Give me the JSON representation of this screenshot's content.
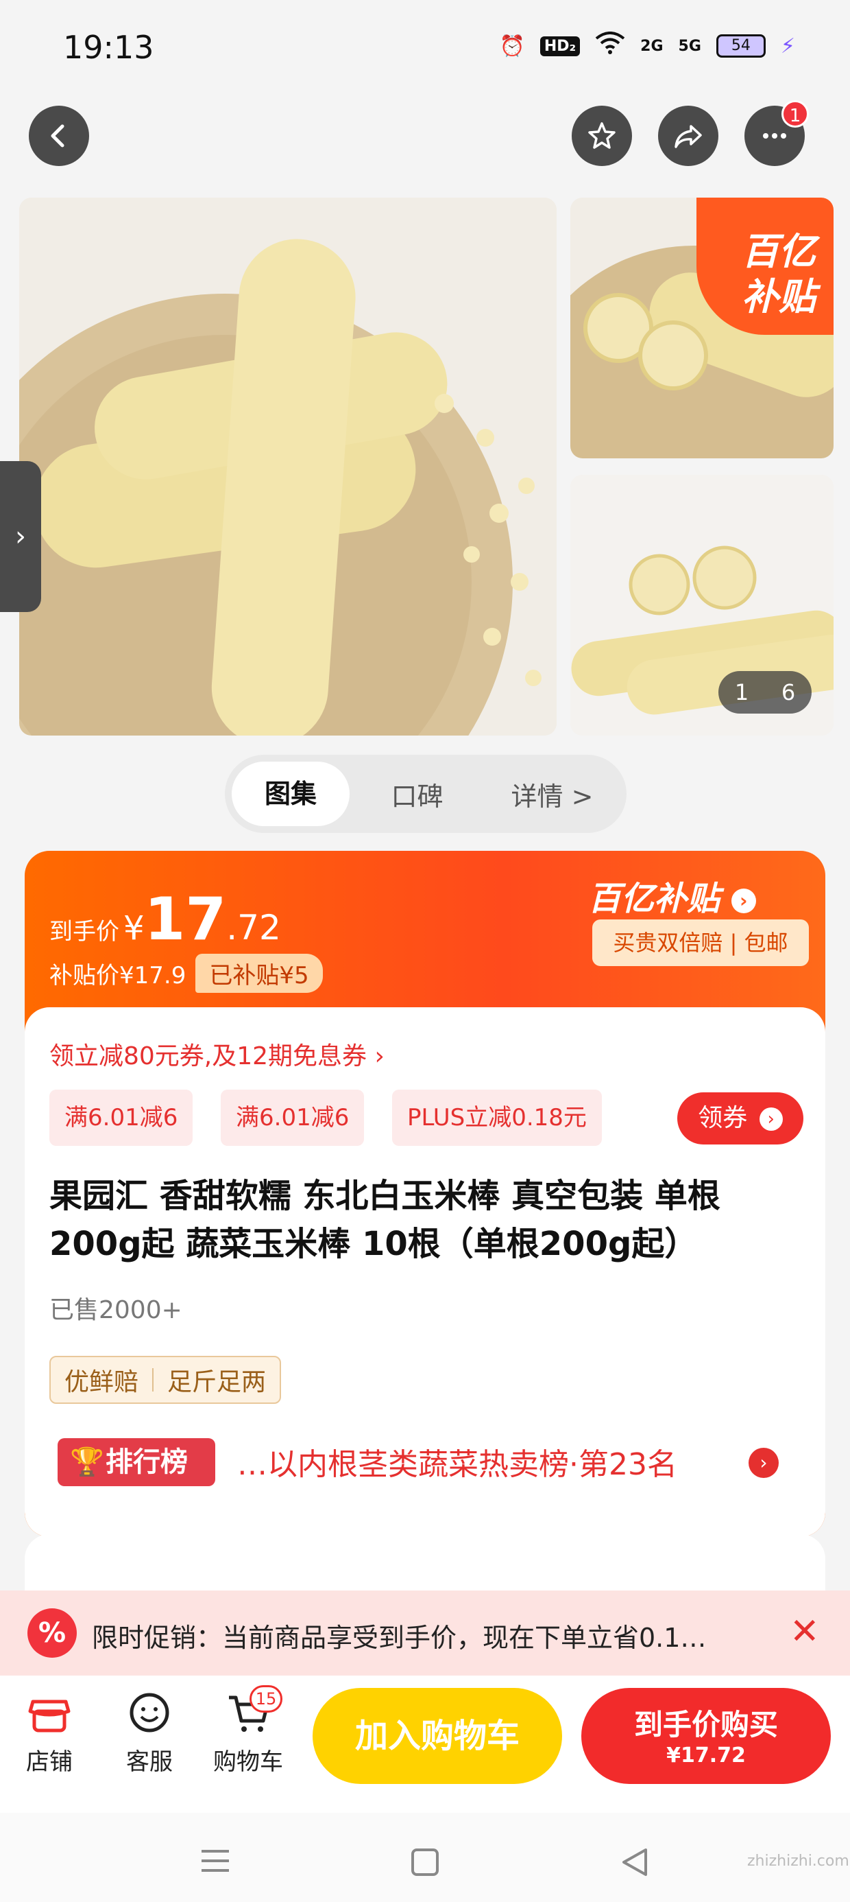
{
  "status_bar": {
    "time": "19:13",
    "hd": "HD₂",
    "net1": "2G",
    "net2": "5G",
    "battery": "54"
  },
  "header": {
    "more_badge": "1"
  },
  "gallery": {
    "counter_current": "1",
    "counter_total": "6",
    "subsidy_badge_line1": "百亿",
    "subsidy_badge_line2": "补贴"
  },
  "tabs": [
    "图集",
    "口碑",
    "详情 >"
  ],
  "price": {
    "final_label": "到手价",
    "currency": "¥",
    "final_int": "17",
    "final_dec": ".72",
    "subsidy_label": "补贴价¥17.9",
    "subsidy_amount": "已补贴¥5",
    "brand": "百亿补贴",
    "guarantee": "买贵双倍赔 | 包邮"
  },
  "coupons": {
    "line": "领立减80元券,及12期免息券 ›",
    "tags": [
      "满6.01减6",
      "满6.01减6",
      "PLUS立减0.18元"
    ],
    "get_button": "领券"
  },
  "product": {
    "title": "果园汇 香甜软糯 东北白玉米棒 真空包装 单根200g起 蔬菜玉米棒 10根（单根200g起）",
    "sold": "已售2000+",
    "tags": [
      "优鲜赔",
      "足斤足两"
    ],
    "rank_label": "排行榜",
    "rank_text": "…以内根茎类蔬菜热卖榜·第23名"
  },
  "promo": {
    "icon": "%",
    "text": "限时促销：当前商品享受到手价，现在下单立省0.1…",
    "close": "✕"
  },
  "bottom": {
    "shop": "店铺",
    "service": "客服",
    "cart": "购物车",
    "cart_badge": "15",
    "add_cart": "加入购物车",
    "buy_line1": "到手价购买",
    "buy_line2": "¥17.72"
  },
  "watermark": "zhizhizhi.com"
}
